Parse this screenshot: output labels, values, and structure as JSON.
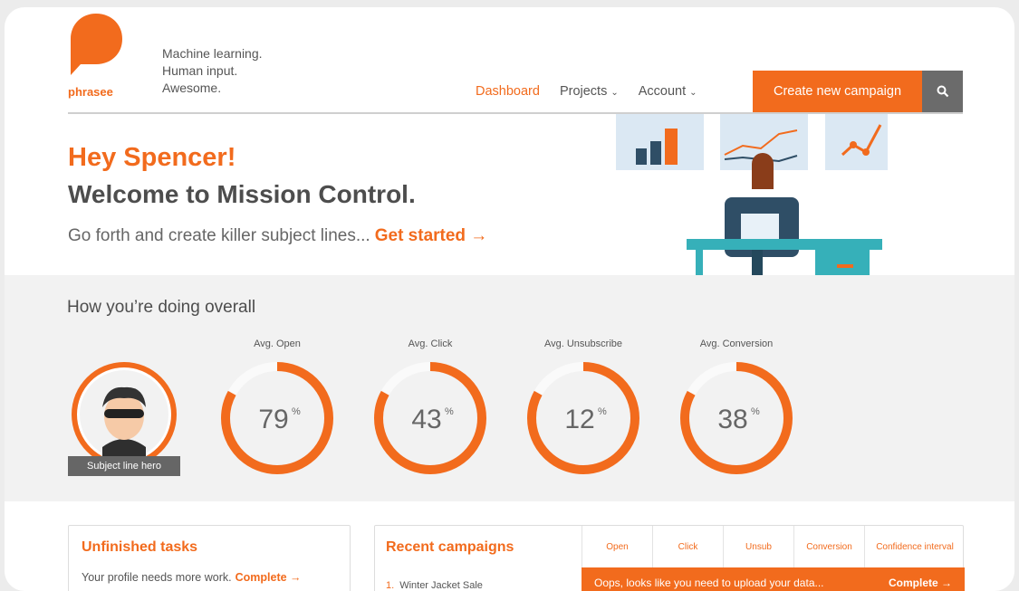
{
  "brand": {
    "logo_text": "phrasee",
    "tagline": [
      "Machine learning.",
      "Human input.",
      "Awesome."
    ],
    "accent_color": "#f26b1d"
  },
  "nav": {
    "dashboard": "Dashboard",
    "projects": "Projects",
    "account": "Account",
    "cta": "Create new campaign",
    "search_icon": "search-icon"
  },
  "hero": {
    "greeting": "Hey Spencer!",
    "welcome": "Welcome to Mission Control.",
    "subtitle": "Go forth and create killer subject lines...",
    "cta_link": "Get started →"
  },
  "stats": {
    "title": "How you’re doing overall",
    "avatar_label": "Subject line hero",
    "gauges": [
      {
        "label": "Avg. Open",
        "value": 79,
        "unit": "%"
      },
      {
        "label": "Avg. Click",
        "value": 43,
        "unit": "%"
      },
      {
        "label": "Avg. Unsubscribe",
        "value": 12,
        "unit": "%"
      },
      {
        "label": "Avg. Conversion",
        "value": 38,
        "unit": "%"
      }
    ]
  },
  "tasks": {
    "title": "Unfinished tasks",
    "line": "Your profile needs more work.",
    "link": "Complete →"
  },
  "recent": {
    "title": "Recent campaigns",
    "columns": [
      "Open",
      "Click",
      "Unsub",
      "Conversion",
      "Confidence interval"
    ],
    "rows": [
      {
        "num": "1.",
        "name": "Winter Jacket Sale"
      }
    ],
    "banner_text": "Oops, looks like you need to upload your data...",
    "banner_link": "Complete →"
  }
}
